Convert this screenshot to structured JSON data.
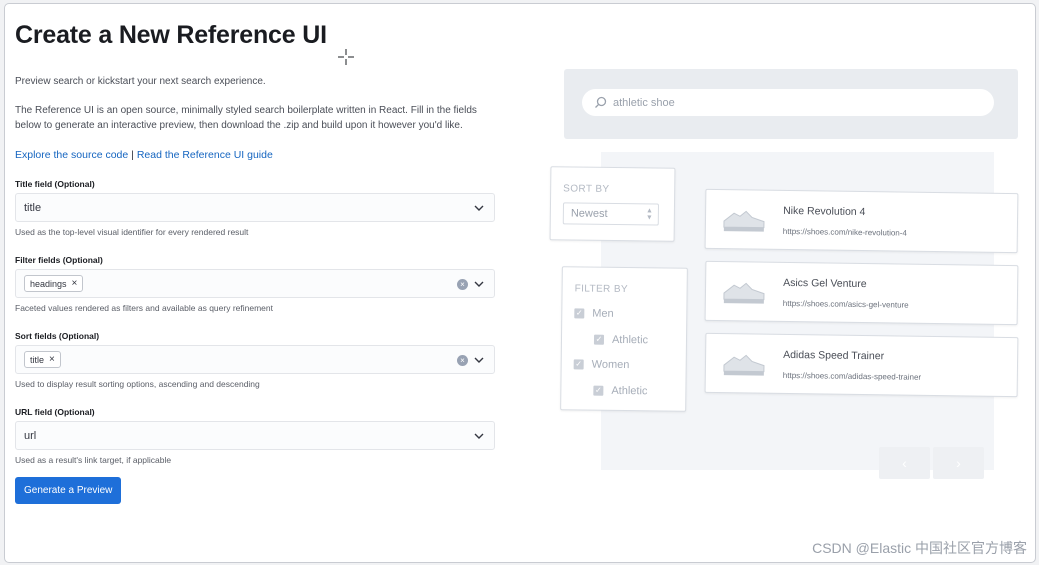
{
  "page": {
    "title": "Create a New Reference UI",
    "intro": "Preview search or kickstart your next search experience.",
    "description": "The Reference UI is an open source, minimally styled search boilerplate written in React. Fill in the fields below to generate an interactive preview, then download the .zip and build upon it however you'd like.",
    "links": {
      "source": "Explore the source code",
      "separator": "|",
      "guide": "Read the Reference UI guide"
    }
  },
  "form": {
    "title_field": {
      "label": "Title field (Optional)",
      "value": "title",
      "help": "Used as the top-level visual identifier for every rendered result"
    },
    "filter_fields": {
      "label": "Filter fields (Optional)",
      "pill": "headings",
      "help": "Faceted values rendered as filters and available as query refinement"
    },
    "sort_fields": {
      "label": "Sort fields (Optional)",
      "pill": "title",
      "help": "Used to display result sorting options, ascending and descending"
    },
    "url_field": {
      "label": "URL field (Optional)",
      "value": "url",
      "help": "Used as a result's link target, if applicable"
    },
    "remove_glyph": "×",
    "clear_glyph": "×",
    "submit_label": "Generate a Preview"
  },
  "preview": {
    "search_placeholder": "athletic shoe",
    "sort": {
      "title": "SORT BY",
      "value": "Newest",
      "arrows": "▲\n▼"
    },
    "filter": {
      "title": "FILTER BY",
      "options": [
        "Men",
        "Athletic",
        "Women",
        "Athletic"
      ],
      "check": "✓"
    },
    "results": [
      {
        "name": "Nike Revolution 4",
        "url": "https://shoes.com/nike-revolution-4"
      },
      {
        "name": "Asics Gel Venture",
        "url": "https://shoes.com/asics-gel-venture"
      },
      {
        "name": "Adidas Speed Trainer",
        "url": "https://shoes.com/adidas-speed-trainer"
      }
    ],
    "pagination": {
      "prev": "‹",
      "next": "›"
    }
  },
  "watermark": "CSDN @Elastic 中国社区官方博客",
  "icons": {
    "search": "search-icon",
    "chevron": "chevron-down-icon",
    "clear": "clear-icon",
    "shoe": "shoe-icon",
    "cursor": "crosshair-cursor-icon"
  },
  "colors": {
    "accent": "#1e6fd9",
    "link": "#1565c0"
  }
}
